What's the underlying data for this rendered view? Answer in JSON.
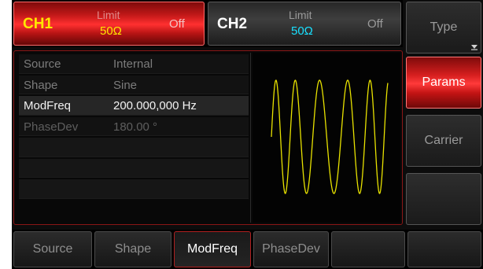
{
  "channels": {
    "ch1": {
      "name": "CH1",
      "limit_label": "Limit",
      "limit_value": "50Ω",
      "state": "Off"
    },
    "ch2": {
      "name": "CH2",
      "limit_label": "Limit",
      "limit_value": "50Ω",
      "state": "Off"
    }
  },
  "params": [
    {
      "label": "Source",
      "value": "Internal"
    },
    {
      "label": "Shape",
      "value": "Sine"
    },
    {
      "label": "ModFreq",
      "value": "200.000,000 Hz"
    },
    {
      "label": "PhaseDev",
      "value": "180.00 °"
    }
  ],
  "side_menu": {
    "type": "Type",
    "params": "Params",
    "carrier": "Carrier",
    "more_icon": "triangle-down-icon"
  },
  "bottom_menu": {
    "source": "Source",
    "shape": "Shape",
    "modfreq": "ModFreq",
    "phasedev": "PhaseDev"
  },
  "waveform": {
    "type": "phase-modulated sine preview",
    "color": "#e8e200"
  },
  "colors": {
    "ch1_accent": "#ffe600",
    "ch2_accent": "#19e0ff",
    "active_red": "#d41e1e"
  }
}
